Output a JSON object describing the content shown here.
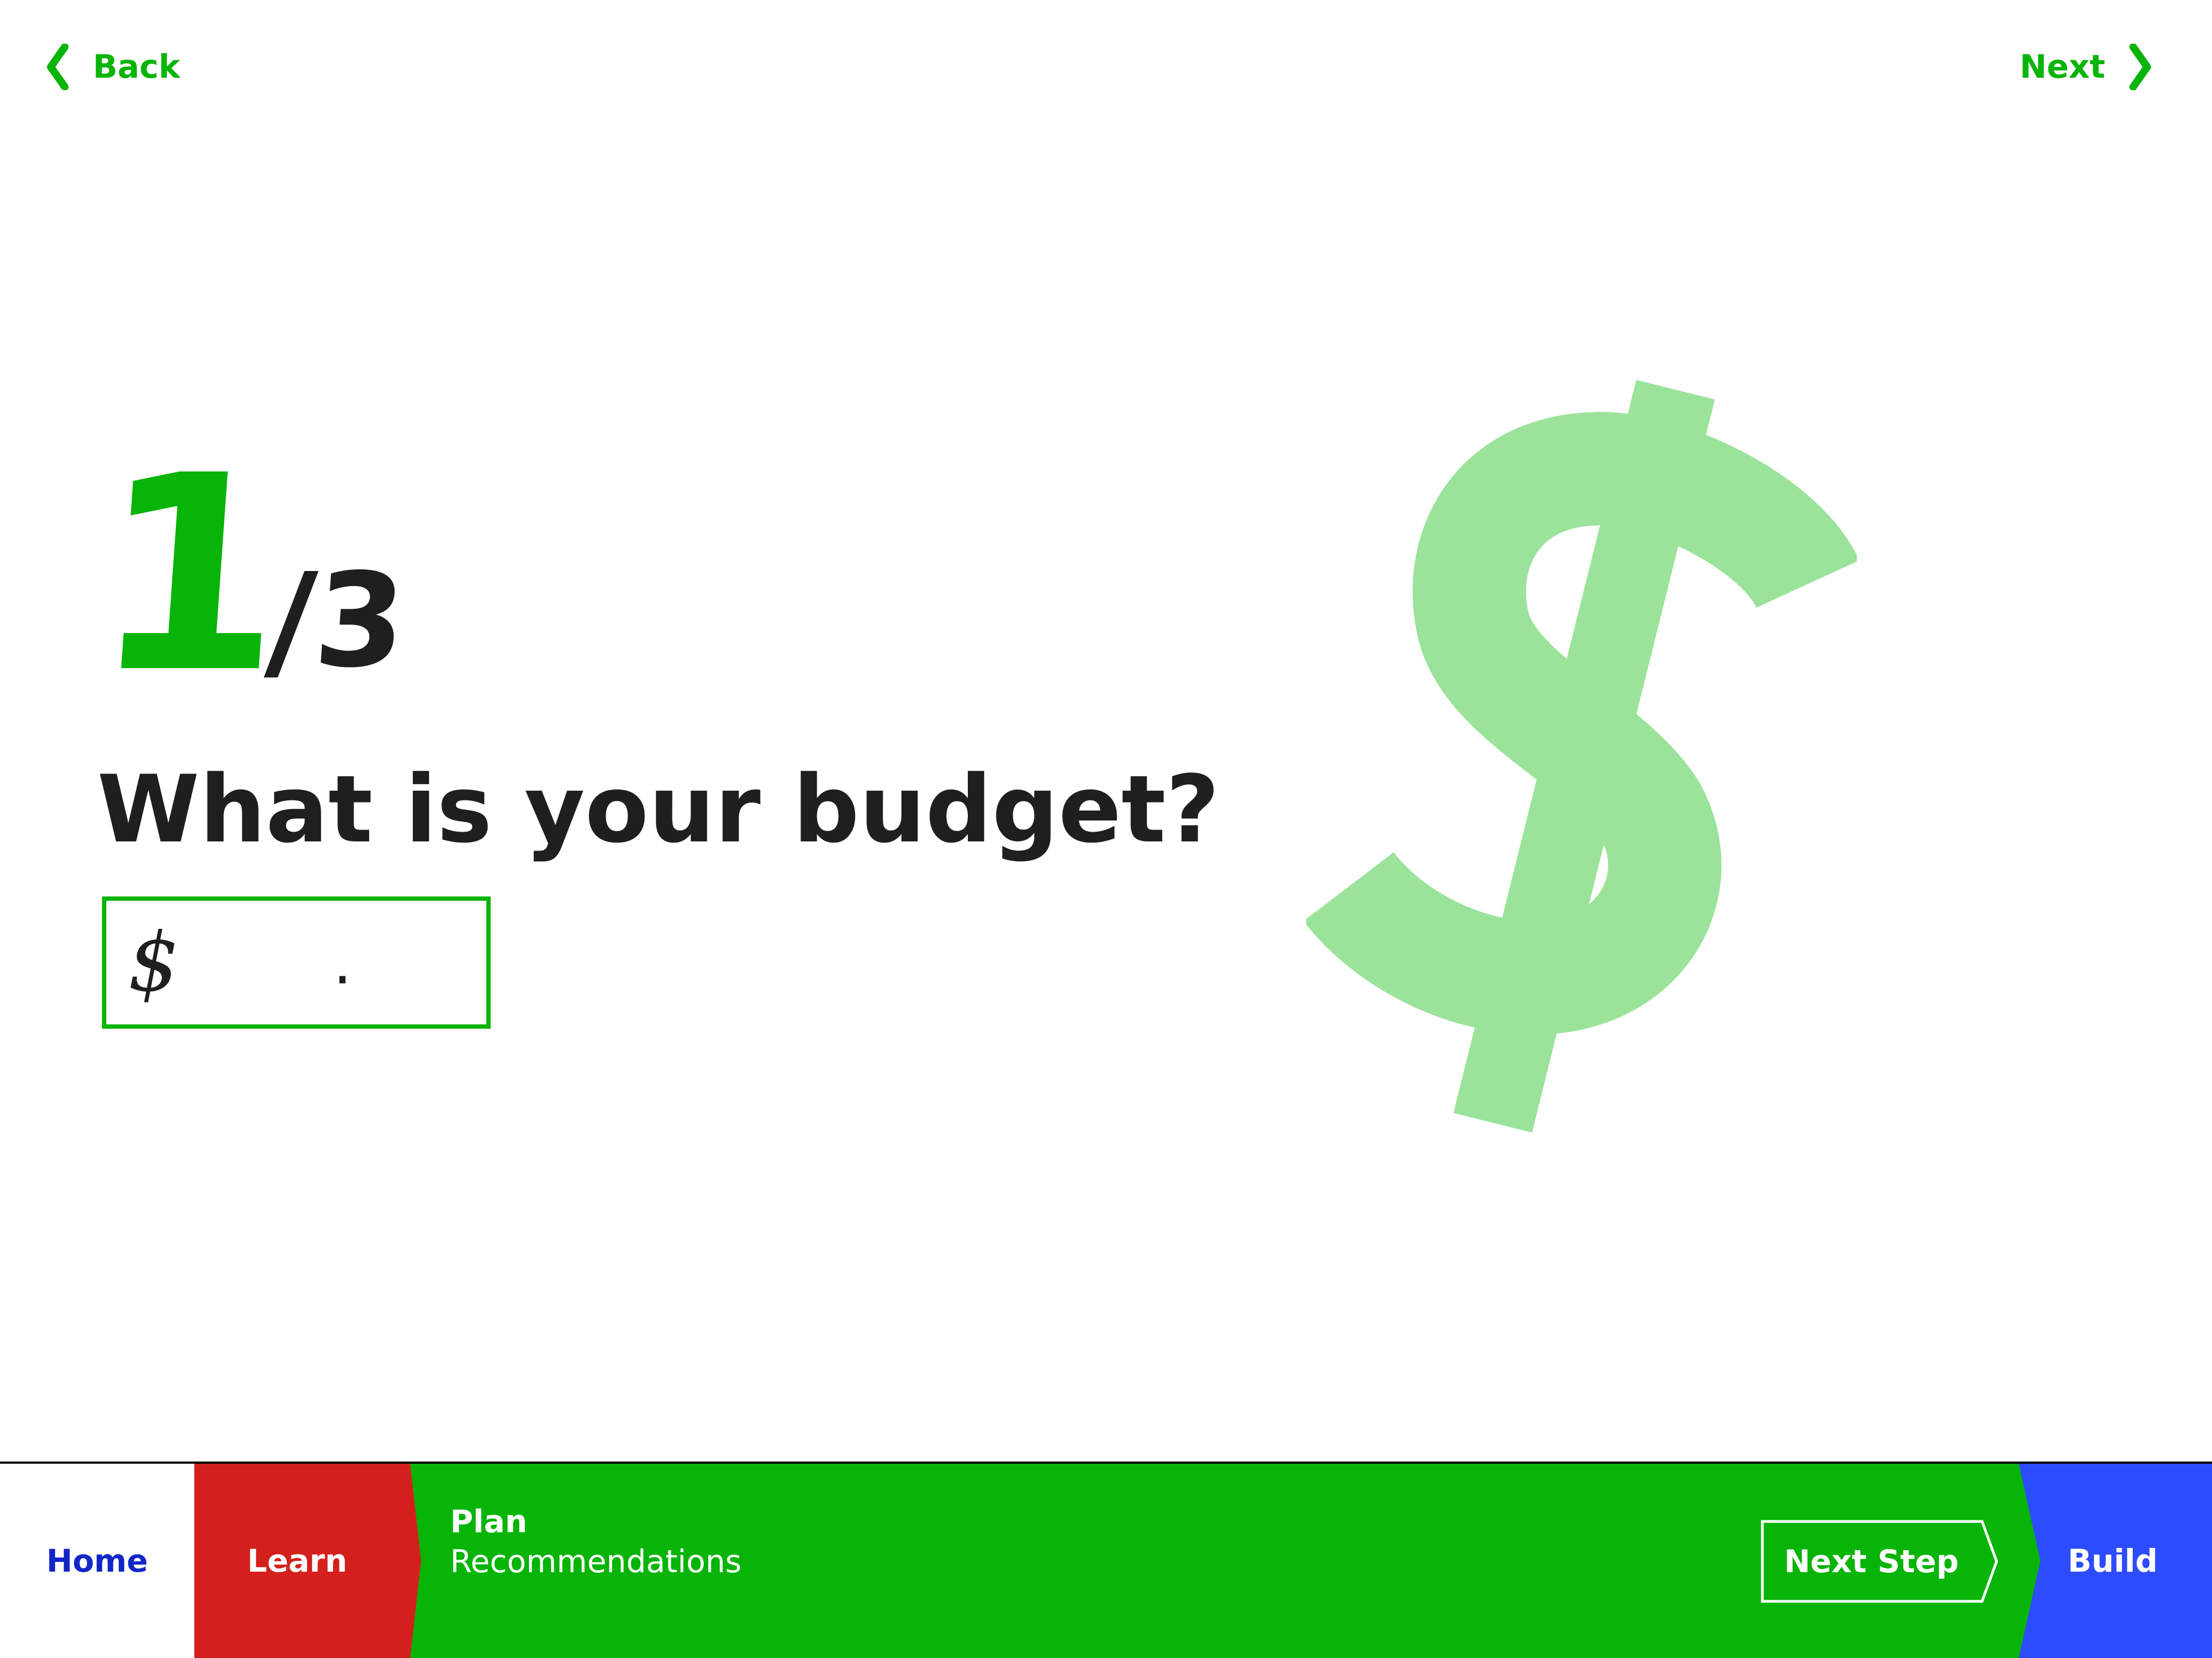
{
  "header": {
    "back_label": "Back",
    "next_label": "Next"
  },
  "progress": {
    "current": "1",
    "total": "/3"
  },
  "question": {
    "text": "What is your budget?",
    "currency_symbol": "$",
    "input_value": "",
    "input_placeholder": "."
  },
  "illustration": {
    "icon": "dollar-sign-icon",
    "color": "#9be39b"
  },
  "bottom_nav": {
    "home_label": "Home",
    "learn_label": "Learn",
    "plan_title": "Plan",
    "plan_subtitle": "Recommendations",
    "next_step_label": "Next Step",
    "build_label": "Build"
  },
  "colors": {
    "accent_green": "#08b408",
    "home_text": "#1326c8",
    "learn_red": "#d4201c",
    "build_blue": "#2e4cff",
    "text_dark": "#1f1f1f"
  }
}
